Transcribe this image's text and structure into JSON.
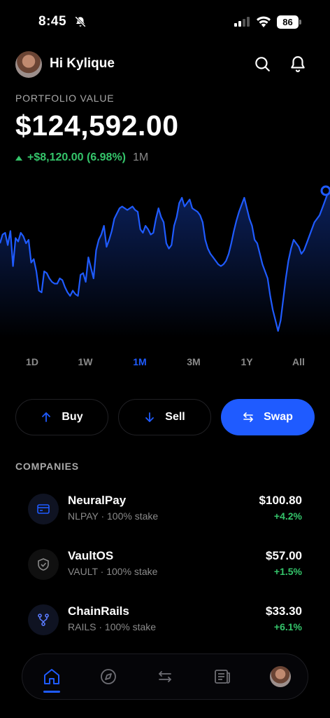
{
  "status_bar": {
    "time": "8:45",
    "battery": "86",
    "icons": [
      "bell-slash-icon",
      "signal-icon",
      "wifi-icon",
      "battery-icon"
    ]
  },
  "header": {
    "greeting": "Hi Kylique",
    "icons": [
      "search-icon",
      "bell-icon"
    ]
  },
  "portfolio": {
    "label": "PORTFOLIO VALUE",
    "value": "$124,592.00",
    "change": "+$8,120.00 (6.98%)",
    "period": "1M"
  },
  "chart_data": {
    "type": "area",
    "values": [
      60,
      65,
      66,
      59,
      67,
      47,
      63,
      61,
      66,
      64,
      60,
      62,
      49,
      51,
      44,
      33,
      32,
      44,
      43,
      40,
      38,
      37,
      37,
      40,
      39,
      35,
      32,
      30,
      33,
      31,
      30,
      42,
      43,
      38,
      52,
      46,
      40,
      56,
      62,
      65,
      70,
      58,
      62,
      67,
      74,
      77,
      80,
      81,
      80,
      79,
      80,
      81,
      79,
      78,
      68,
      66,
      70,
      68,
      65,
      66,
      74,
      80,
      75,
      72,
      60,
      57,
      59,
      70,
      75,
      83,
      86,
      81,
      83,
      85,
      80,
      79,
      78,
      76,
      72,
      62,
      57,
      54,
      52,
      50,
      48,
      47,
      48,
      50,
      54,
      60,
      67,
      73,
      78,
      82,
      86,
      80,
      74,
      70,
      62,
      60,
      54,
      48,
      44,
      40,
      30,
      22,
      16,
      10,
      16,
      28,
      40,
      50,
      57,
      62,
      60,
      58,
      54,
      56,
      60,
      64,
      68,
      72,
      74,
      76,
      80,
      84,
      88,
      90
    ],
    "color": "#1f5bff"
  },
  "ranges": {
    "items": [
      "1D",
      "1W",
      "1M",
      "3M",
      "1Y",
      "All"
    ],
    "active": "1M"
  },
  "actions": {
    "buy": "Buy",
    "sell": "Sell",
    "swap": "Swap"
  },
  "companies": {
    "label": "COMPANIES",
    "items": [
      {
        "name": "NeuralPay",
        "sub": "NLPAY · 100% stake",
        "price": "$100.80",
        "change": "+4.2%",
        "icon": "card-icon"
      },
      {
        "name": "VaultOS",
        "sub": "VAULT · 100% stake",
        "price": "$57.00",
        "change": "+1.5%",
        "icon": "shield-check-icon"
      },
      {
        "name": "ChainRails",
        "sub": "RAILS · 100% stake",
        "price": "$33.30",
        "change": "+6.1%",
        "icon": "git-fork-icon"
      }
    ]
  },
  "bottom_nav": {
    "items": [
      "home-icon",
      "compass-icon",
      "swap-arrows-icon",
      "news-icon",
      "profile-avatar"
    ],
    "active": "home-icon"
  },
  "colors": {
    "accent": "#1f5bff",
    "positive": "#34c46a",
    "background": "#000000"
  }
}
